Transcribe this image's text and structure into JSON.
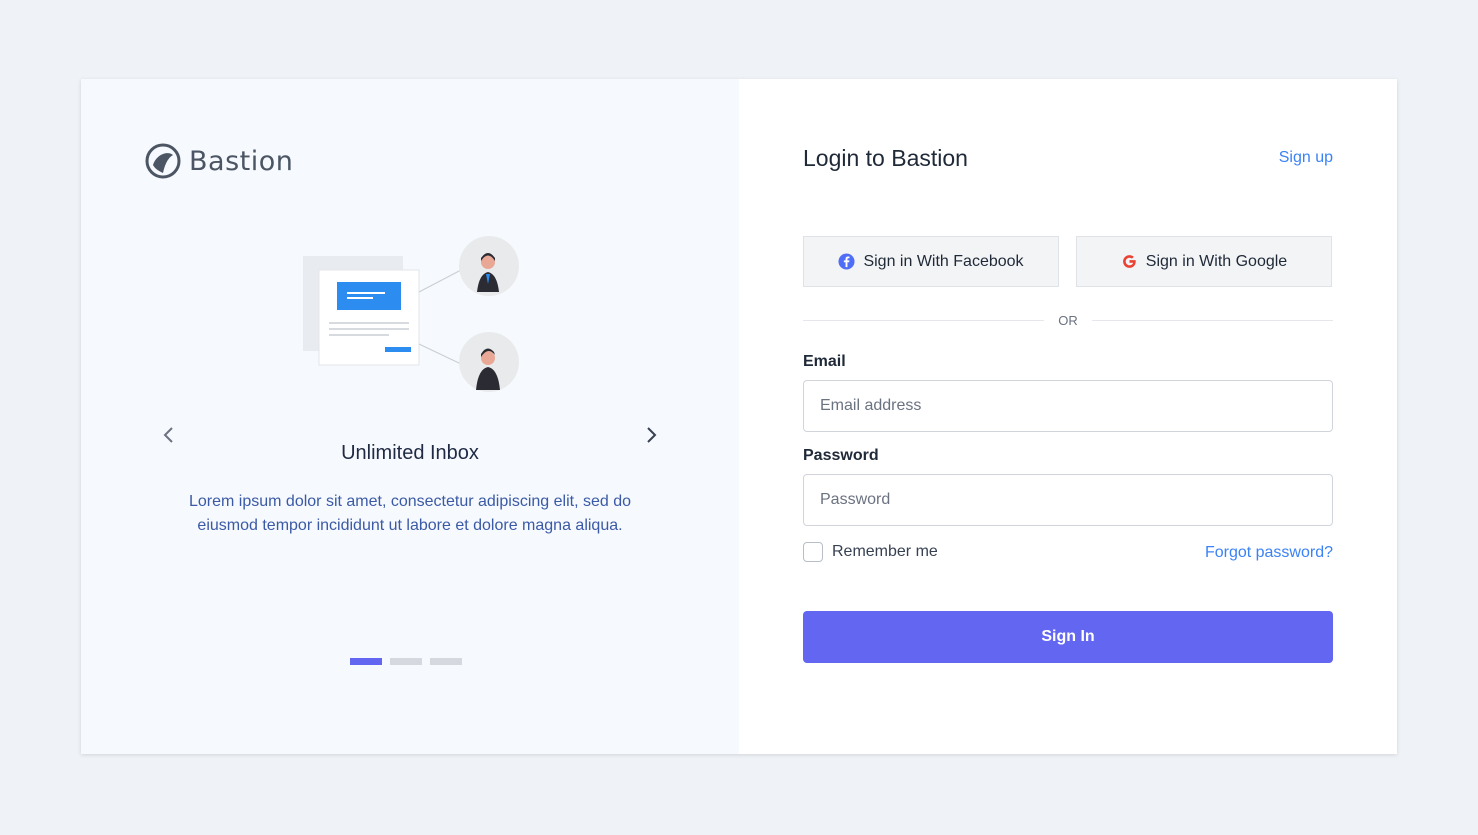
{
  "brand": {
    "name": "Bastion",
    "logo_icon": "globe-logo-icon"
  },
  "carousel": {
    "title": "Unlimited Inbox",
    "description": "Lorem ipsum dolor sit amet, consectetur adipiscing elit, sed do eiusmod tempor incididunt ut labore et dolore magna aliqua.",
    "prev_icon": "chevron-left-icon",
    "next_icon": "chevron-right-icon",
    "slides_count": 3,
    "active_slide": 1
  },
  "login": {
    "title": "Login to Bastion",
    "signup_label": "Sign up",
    "facebook_label": "Sign in With Facebook",
    "google_label": "Sign in With Google",
    "or_label": "OR",
    "email_label": "Email",
    "email_placeholder": "Email address",
    "email_value": "",
    "password_label": "Password",
    "password_placeholder": "Password",
    "password_value": "",
    "remember_label": "Remember me",
    "remember_checked": false,
    "forgot_label": "Forgot password?",
    "submit_label": "Sign In"
  },
  "colors": {
    "accent": "#6366f1",
    "link": "#3b82f6",
    "left_bg": "#f6f9fd",
    "page_bg": "#eff2f6"
  }
}
